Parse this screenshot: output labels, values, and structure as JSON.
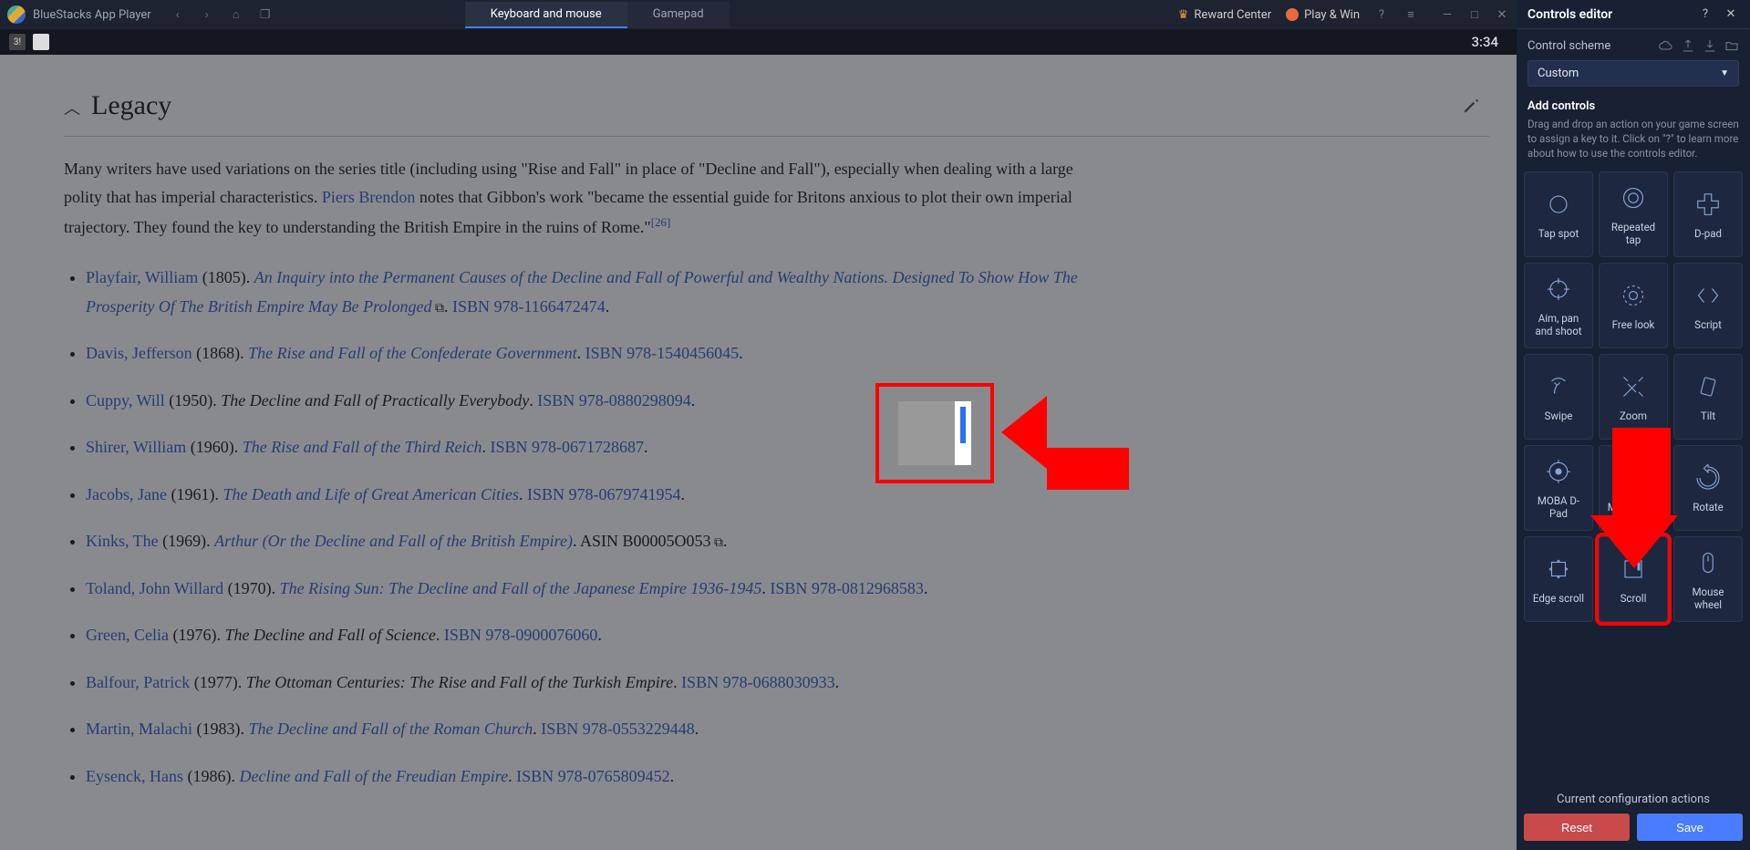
{
  "titlebar": {
    "title": "BlueStacks App Player",
    "tabs": [
      "Keyboard and mouse",
      "Gamepad"
    ],
    "active_tab": 0,
    "right": {
      "reward": "Reward Center",
      "play": "Play & Win"
    }
  },
  "subbar": {
    "time": "3:34"
  },
  "wiki": {
    "heading": "Legacy",
    "para_pre": "Many writers have used variations on the series title (including using \"Rise and Fall\" in place of \"Decline and Fall\"), especially when dealing with a large polity that has imperial characteristics. ",
    "para_link": "Piers Brendon",
    "para_post": " notes that Gibbon's work \"became the essential guide for Britons anxious to plot their own imperial trajectory. They found the key to understanding the British Empire in the ruins of Rome.\"",
    "ref": "[26]",
    "items": [
      {
        "author": "Playfair, William",
        "year": " (1805). ",
        "title": "An Inquiry into the Permanent Causes of the Decline and Fall of Powerful and Wealthy Nations. Designed To Show How The Prosperity Of The British Empire May Be Prolonged",
        "ext": true,
        "post": ". ",
        "isbn": "ISBN 978-1166472474",
        "tail": "."
      },
      {
        "author": "Davis, Jefferson",
        "year": " (1868). ",
        "title": "The Rise and Fall of the Confederate Government",
        "post": ". ",
        "isbn": "ISBN 978-1540456045",
        "tail": "."
      },
      {
        "author": "Cuppy, Will",
        "year": " (1950). ",
        "plain_title": "The Decline and Fall of Practically Everybody",
        "post": ". ",
        "isbn": "ISBN 978-0880298094",
        "tail": "."
      },
      {
        "author": "Shirer, William",
        "year": " (1960). ",
        "title": "The Rise and Fall of the Third Reich",
        "post": ". ",
        "isbn": "ISBN 978-0671728687",
        "tail": "."
      },
      {
        "author": "Jacobs, Jane",
        "year": " (1961). ",
        "title": "The Death and Life of Great American Cities",
        "post": ". ",
        "isbn": "ISBN 978-0679741954",
        "tail": "."
      },
      {
        "author": "Kinks, The",
        "year": " (1969). ",
        "title": "Arthur (Or the Decline and Fall of the British Empire)",
        "post": ". ",
        "asin": "ASIN B00005O053",
        "ext2": true,
        "tail": "."
      },
      {
        "author": "Toland, John Willard",
        "year": " (1970). ",
        "title": "The Rising Sun: The Decline and Fall of the Japanese Empire 1936-1945",
        "post": ". ",
        "isbn": "ISBN 978-0812968583",
        "tail": "."
      },
      {
        "author": "Green, Celia",
        "year": " (1976). ",
        "plain_title": "The Decline and Fall of Science",
        "post": ". ",
        "isbn": "ISBN 978-0900076060",
        "tail": "."
      },
      {
        "author": "Balfour, Patrick",
        "year": " (1977). ",
        "plain_title": "The Ottoman Centuries: The Rise and Fall of the Turkish Empire",
        "post": ". ",
        "isbn": "ISBN 978-0688030933",
        "tail": "."
      },
      {
        "author": "Martin, Malachi",
        "year": " (1983). ",
        "title": "The Decline and Fall of the Roman Church",
        "post": ". ",
        "isbn": "ISBN 978-0553229448",
        "tail": "."
      },
      {
        "author": "Eysenck, Hans",
        "year": " (1986). ",
        "title": "Decline and Fall of the Freudian Empire",
        "post": ". ",
        "isbn": "ISBN 978-0765809452",
        "tail": "."
      }
    ]
  },
  "sidebar": {
    "title": "Controls editor",
    "scheme_label": "Control scheme",
    "scheme_selected": "Custom",
    "add_title": "Add controls",
    "add_help": "Drag and drop an action on your game screen to assign a key to it. Click on \"?\" to learn more about how to use the controls editor.",
    "tiles": [
      {
        "label": "Tap spot",
        "icon": "circle"
      },
      {
        "label": "Repeated tap",
        "icon": "circles"
      },
      {
        "label": "D-pad",
        "icon": "dpad"
      },
      {
        "label": "Aim, pan and shoot",
        "icon": "crosshair"
      },
      {
        "label": "Free look",
        "icon": "freelook"
      },
      {
        "label": "Script",
        "icon": "script"
      },
      {
        "label": "Swipe",
        "icon": "swipe"
      },
      {
        "label": "Zoom",
        "icon": "zoom"
      },
      {
        "label": "Tilt",
        "icon": "tilt"
      },
      {
        "label": "MOBA D-Pad",
        "icon": "moba"
      },
      {
        "label": "MOBA Skill",
        "icon": "skill"
      },
      {
        "label": "Rotate",
        "icon": "rotate"
      },
      {
        "label": "Edge scroll",
        "icon": "edge"
      },
      {
        "label": "Scroll",
        "icon": "scroll",
        "hl": true
      },
      {
        "label": "Mouse wheel",
        "icon": "mouse"
      }
    ],
    "footer_label": "Current configuration actions",
    "reset": "Reset",
    "save": "Save"
  }
}
